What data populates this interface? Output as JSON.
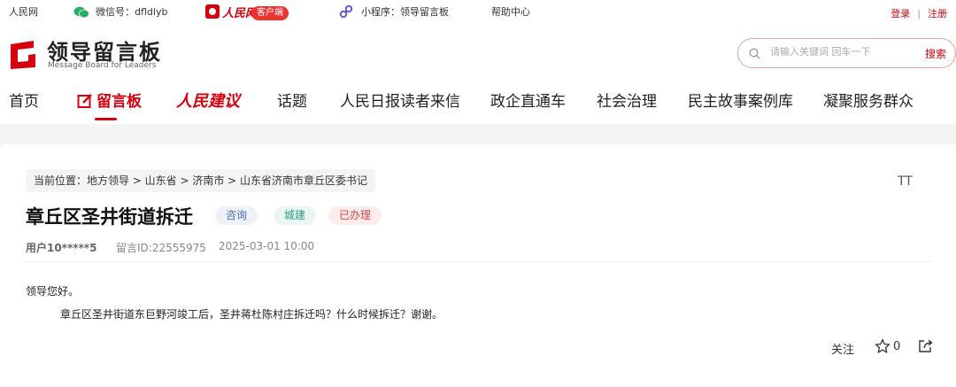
{
  "topbar": {
    "site": "人民网",
    "wechat_label": "微信号：dfldlyb",
    "app_brand": "人民网+",
    "app_badge": "客户端",
    "miniprogram": "小程序：领导留言板",
    "help": "帮助中心",
    "login": "登录",
    "separator": "|",
    "register": "注册"
  },
  "header": {
    "logo_title": "领导留言板",
    "logo_subtitle": "Message Board for Leaders",
    "search_placeholder": "请输入关键词 回车一下",
    "search_button": "搜索"
  },
  "nav": {
    "items": [
      {
        "label": "首页"
      },
      {
        "label": "留言板",
        "active": true
      },
      {
        "label": "人民建议"
      },
      {
        "label": "话题"
      },
      {
        "label": "人民日报读者来信"
      },
      {
        "label": "政企直通车"
      },
      {
        "label": "社会治理"
      },
      {
        "label": "民主故事案例库"
      },
      {
        "label": "凝聚服务群众"
      }
    ]
  },
  "message": {
    "breadcrumb": "当前位置：地方领导 > 山东省 > 济南市 > 山东省济南市章丘区委书记",
    "font_size_icon": "TT",
    "title": "章丘区圣井街道拆迁",
    "tags": [
      "咨询",
      "城建",
      "已办理"
    ],
    "user": "用户10*****5",
    "message_id": "留言ID:22555975",
    "datetime": "2025-03-01 10:00",
    "greeting": "领导您好。",
    "body": "章丘区圣井街道东巨野河竣工后，圣井蒋杜陈村庄拆迁吗？什么时候拆迁？谢谢。",
    "follow_label": "关注",
    "star_count": "0"
  },
  "colors": {
    "brand_red": "#d7000f",
    "tag_consult": "#4b6fb5",
    "tag_city": "#2d9a84",
    "tag_done": "#d94747"
  },
  "icons": [
    "wechat-icon",
    "app-icon",
    "miniprogram-icon",
    "logo-mark-icon",
    "search-icon",
    "pencil-icon",
    "font-size-icon",
    "star-icon",
    "share-icon"
  ]
}
